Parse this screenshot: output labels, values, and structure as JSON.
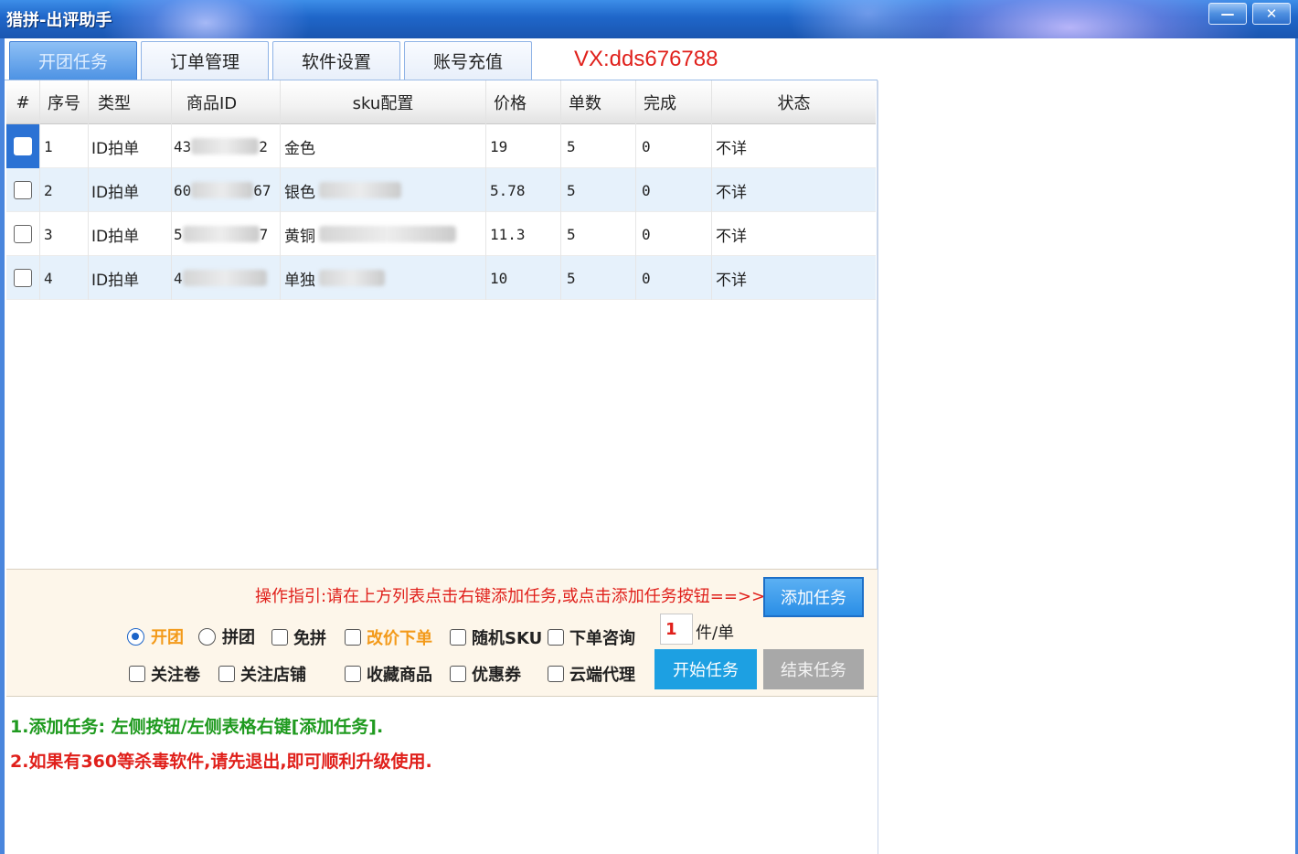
{
  "window": {
    "title": "猎拼-出评助手",
    "minimize": "—",
    "close": "✕"
  },
  "tabs": [
    {
      "label": "开团任务",
      "active": true
    },
    {
      "label": "订单管理",
      "active": false
    },
    {
      "label": "软件设置",
      "active": false
    },
    {
      "label": "账号充值",
      "active": false
    }
  ],
  "contact": "VX:dds676788",
  "table": {
    "headers": [
      "#",
      "序号",
      "类型",
      "商品ID",
      "sku配置",
      "价格",
      "单数",
      "完成",
      "状态"
    ],
    "rows": [
      {
        "seq": "1",
        "type": "ID拍单",
        "pid_a": "43",
        "pid_b": "2",
        "sku": "金色",
        "price": "19",
        "count": "5",
        "done": "0",
        "status": "不详",
        "selected": true
      },
      {
        "seq": "2",
        "type": "ID拍单",
        "pid_a": "60",
        "pid_b": "67",
        "sku": "银色",
        "price": "5.78",
        "count": "5",
        "done": "0",
        "status": "不详",
        "selected": false
      },
      {
        "seq": "3",
        "type": "ID拍单",
        "pid_a": "5",
        "pid_b": "7",
        "sku": "黄铜",
        "price": "11.3",
        "count": "5",
        "done": "0",
        "status": "不详",
        "selected": false
      },
      {
        "seq": "4",
        "type": "ID拍单",
        "pid_a": "4",
        "pid_b": "",
        "sku": "单独",
        "price": "10",
        "count": "5",
        "done": "0",
        "status": "不详",
        "selected": false
      }
    ]
  },
  "controls": {
    "guide": "操作指引:请在上方列表点击右键添加任务,或点击添加任务按钮==>>",
    "add_task": "添加任务",
    "start_task": "开始任务",
    "stop_task": "结束任务",
    "mode_options": [
      {
        "label": "开团",
        "checked": true
      },
      {
        "label": "拼团",
        "checked": false
      }
    ],
    "row1_checks": [
      "免拼",
      "改价下单",
      "随机SKU",
      "下单咨询"
    ],
    "row2_checks": [
      "关注卷",
      "关注店铺",
      "收藏商品",
      "优惠券",
      "云端代理"
    ],
    "qty_value": "1",
    "qty_unit": "件/单"
  },
  "messages": [
    "1.添加任务: 左侧按钮/左侧表格右键[添加任务].",
    "2.如果有360等杀毒软件,请先退出,即可顺利升级使用."
  ],
  "colors": {
    "titlebar": "#1f66c9",
    "accent_red": "#e0201b",
    "accent_green": "#1f9a1f",
    "accent_orange": "#f39a1a",
    "start_button": "#1da0e2"
  }
}
